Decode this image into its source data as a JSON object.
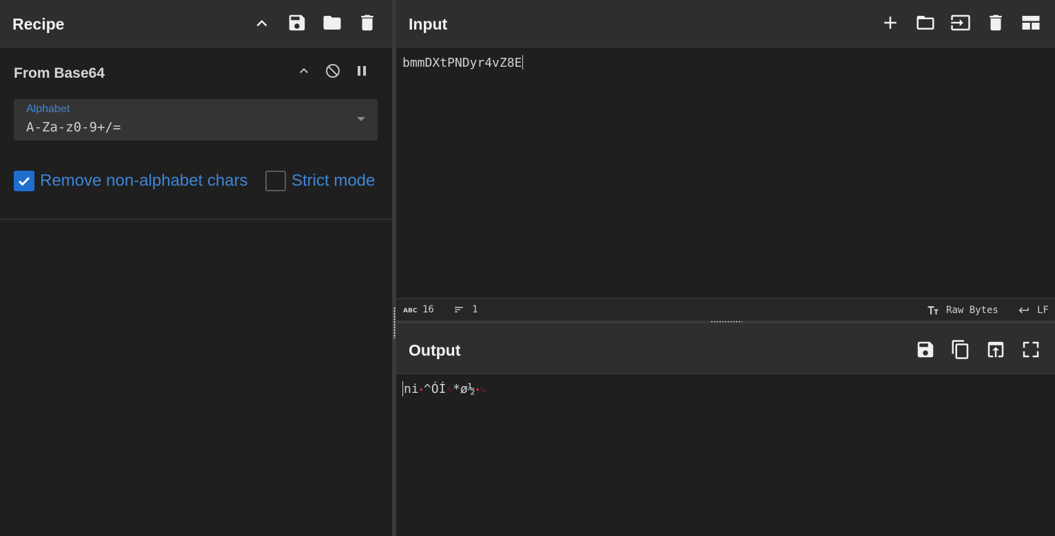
{
  "recipe": {
    "title": "Recipe",
    "operation": {
      "name": "From Base64",
      "alphabet_label": "Alphabet",
      "alphabet_value": "A-Za-z0-9+/=",
      "remove_non_alphabet_label": "Remove non-alphabet chars",
      "remove_non_alphabet_checked": true,
      "strict_mode_label": "Strict mode",
      "strict_mode_checked": false
    }
  },
  "input": {
    "title": "Input",
    "text": "bmmDXtPNDyr4vZ8E",
    "status": {
      "length": "16",
      "lines": "1",
      "encoding": "Raw Bytes",
      "eol": "LF"
    }
  },
  "output": {
    "title": "Output",
    "segments": [
      {
        "text": "ni",
        "ctrl": false
      },
      {
        "text": "•",
        "ctrl": true
      },
      {
        "text": "^ÓÍ",
        "ctrl": false
      },
      {
        "text": "␏",
        "ctrl": true
      },
      {
        "text": "*ø½",
        "ctrl": false
      },
      {
        "text": "•",
        "ctrl": true
      },
      {
        "text": "␄",
        "ctrl": true
      }
    ]
  },
  "colors": {
    "accent": "#1e6fd0",
    "label_blue": "#3d86d6",
    "control_char_red": "#e03030",
    "panel_bg": "#1f1f1f",
    "header_bg": "#2e2e2e"
  }
}
